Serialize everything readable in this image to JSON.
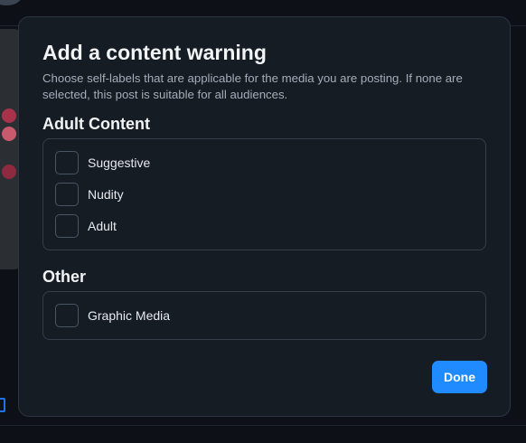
{
  "dialog": {
    "title": "Add a content warning",
    "description": "Choose self-labels that are applicable for the media you are posting. If none are selected, this post is suitable for all audiences.",
    "sections": [
      {
        "heading": "Adult Content",
        "options": [
          {
            "label": "Suggestive",
            "checked": false
          },
          {
            "label": "Nudity",
            "checked": false
          },
          {
            "label": "Adult",
            "checked": false
          }
        ]
      },
      {
        "heading": "Other",
        "options": [
          {
            "label": "Graphic Media",
            "checked": false
          }
        ]
      }
    ],
    "done_label": "Done"
  },
  "colors": {
    "accent": "#208bfe",
    "modal_bg": "#161c24",
    "border": "#343e4b",
    "text_primary": "#f1f3f5",
    "text_secondary": "#a3adb9"
  }
}
